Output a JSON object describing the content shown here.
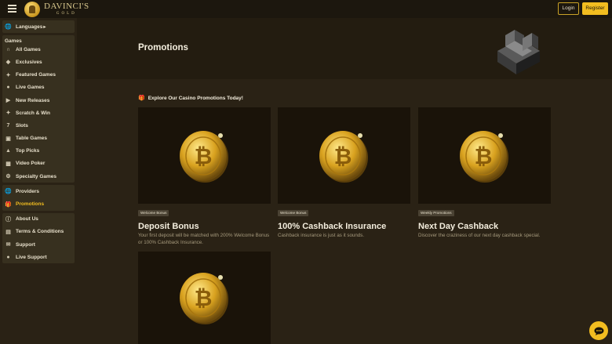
{
  "header": {
    "logo_main": "DAVINCI'S",
    "logo_sub": "GOLD",
    "login_label": "Login",
    "register_label": "Register"
  },
  "sidebar": {
    "languages_label": "Languages",
    "games_heading": "Games",
    "games": [
      {
        "label": "All Games",
        "icon": "horseshoe-icon"
      },
      {
        "label": "Exclusives",
        "icon": "diamond-icon"
      },
      {
        "label": "Featured Games",
        "icon": "star-icon"
      },
      {
        "label": "Live Games",
        "icon": "dealer-icon"
      },
      {
        "label": "New Releases",
        "icon": "megaphone-icon"
      },
      {
        "label": "Scratch & Win",
        "icon": "scratch-icon"
      },
      {
        "label": "Slots",
        "icon": "slot-seven-icon"
      },
      {
        "label": "Table Games",
        "icon": "table-icon"
      },
      {
        "label": "Top Picks",
        "icon": "thumbs-up-icon"
      },
      {
        "label": "Video Poker",
        "icon": "video-poker-icon"
      },
      {
        "label": "Specialty Games",
        "icon": "gear-icon"
      }
    ],
    "providers_label": "Providers",
    "promotions_label": "Promotions",
    "info": [
      {
        "label": "About Us",
        "icon": "info-icon"
      },
      {
        "label": "Terms & Conditions",
        "icon": "document-icon"
      },
      {
        "label": "Support",
        "icon": "mail-icon"
      },
      {
        "label": "Live Support",
        "icon": "chat-icon"
      }
    ]
  },
  "hero": {
    "title": "Promotions"
  },
  "section": {
    "title": "Explore Our Casino Promotions Today!"
  },
  "promotions": [
    {
      "badge": "Welcome Bonus",
      "title": "Deposit Bonus",
      "desc": "Your first deposit will be matched with 200% Welcome Bonus or 100% Cashback Insurance."
    },
    {
      "badge": "Welcome Bonus",
      "title": "100% Cashback Insurance",
      "desc": "Cashback insurance is just as it sounds."
    },
    {
      "badge": "Weekly Promotions",
      "title": "Next Day Cashback",
      "desc": "Discover the craziness of our next day cashback special."
    }
  ],
  "colors": {
    "accent": "#f2bd20",
    "bg": "#2a2215",
    "panel": "#37301f"
  }
}
